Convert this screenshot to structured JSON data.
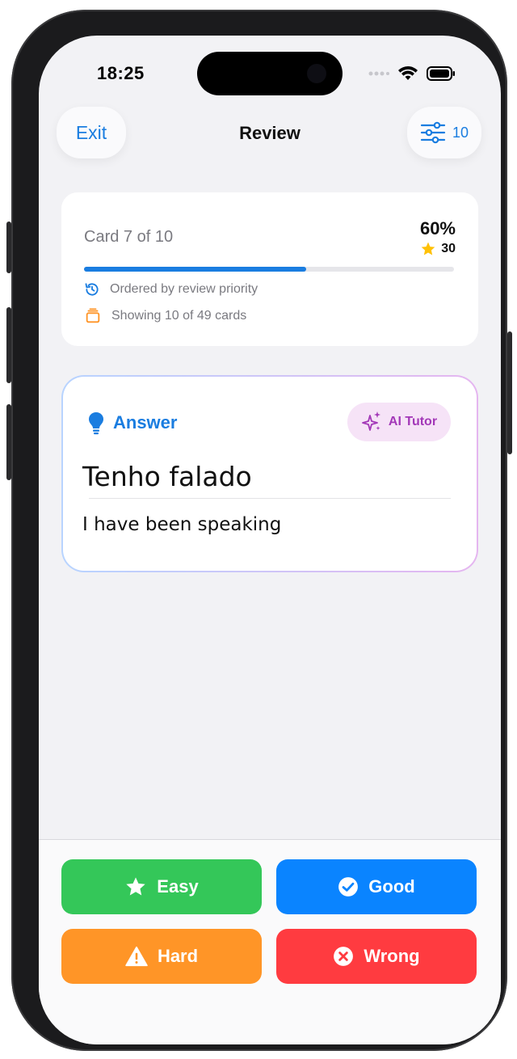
{
  "status_bar": {
    "time": "18:25"
  },
  "nav": {
    "exit_label": "Exit",
    "title": "Review",
    "filter_count": "10"
  },
  "progress": {
    "card_label": "Card 7 of 10",
    "percent_label": "60%",
    "percent_value": 60,
    "stars": "30",
    "order_text": "Ordered by review priority",
    "showing_text": "Showing 10 of 49 cards"
  },
  "answer": {
    "header": "Answer",
    "ai_tutor_label": "AI Tutor",
    "term": "Tenho falado",
    "translation": "I have been speaking"
  },
  "rating": {
    "easy": "Easy",
    "good": "Good",
    "hard": "Hard",
    "wrong": "Wrong"
  },
  "colors": {
    "accent": "#1a7de0",
    "easy": "#34c759",
    "good": "#0a84ff",
    "hard": "#ff9527",
    "wrong": "#ff3b40",
    "ai_tutor": "#a338b8"
  }
}
